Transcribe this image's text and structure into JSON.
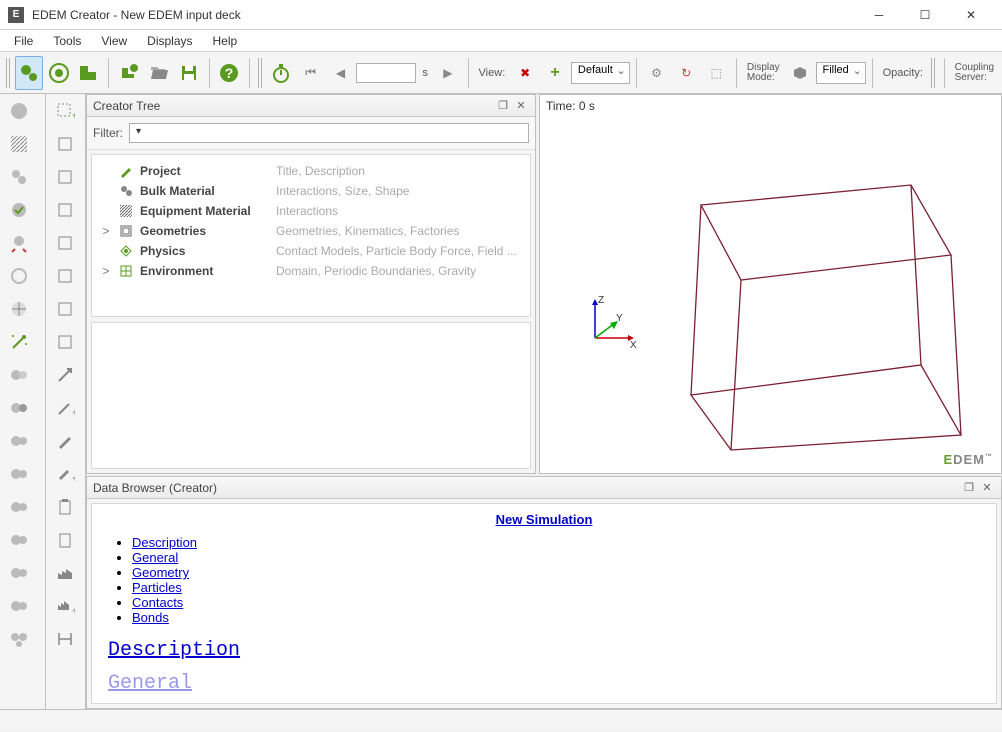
{
  "window": {
    "app_icon": "E",
    "title": "EDEM Creator - New EDEM input deck"
  },
  "menu": {
    "items": [
      "File",
      "Tools",
      "View",
      "Displays",
      "Help"
    ]
  },
  "toolbar": {
    "time_unit": "s",
    "time_value": "",
    "view_label": "View:",
    "view_default": "Default",
    "display_mode_label": "Display\nMode:",
    "display_mode_value": "Filled",
    "opacity_label": "Opacity:",
    "coupling_label": "Coupling\nServer:"
  },
  "creator_tree": {
    "title": "Creator Tree",
    "filter_label": "Filter:",
    "filter_value": "",
    "items": [
      {
        "expand": "",
        "icon": "pencil",
        "name": "Project",
        "desc": "Title, Description"
      },
      {
        "expand": "",
        "icon": "bulk",
        "name": "Bulk Material",
        "desc": "Interactions, Size, Shape"
      },
      {
        "expand": "",
        "icon": "equip",
        "name": "Equipment Material",
        "desc": "Interactions"
      },
      {
        "expand": ">",
        "icon": "geom",
        "name": "Geometries",
        "desc": "Geometries, Kinematics, Factories"
      },
      {
        "expand": "",
        "icon": "physics",
        "name": "Physics",
        "desc": "Contact Models, Particle Body Force, Field ..."
      },
      {
        "expand": ">",
        "icon": "env",
        "name": "Environment",
        "desc": "Domain, Periodic Boundaries, Gravity"
      }
    ]
  },
  "viewport": {
    "time": "Time: 0 s",
    "brand_prefix": "E",
    "brand": "DEM",
    "axes": {
      "x": "X",
      "y": "Y",
      "z": "Z"
    }
  },
  "data_browser": {
    "title": "Data Browser (Creator)",
    "sim_title": "New Simulation",
    "links": [
      "Description",
      "General",
      "Geometry",
      "Particles",
      "Contacts",
      "Bonds"
    ],
    "heading1": "Description",
    "heading2": "General"
  }
}
